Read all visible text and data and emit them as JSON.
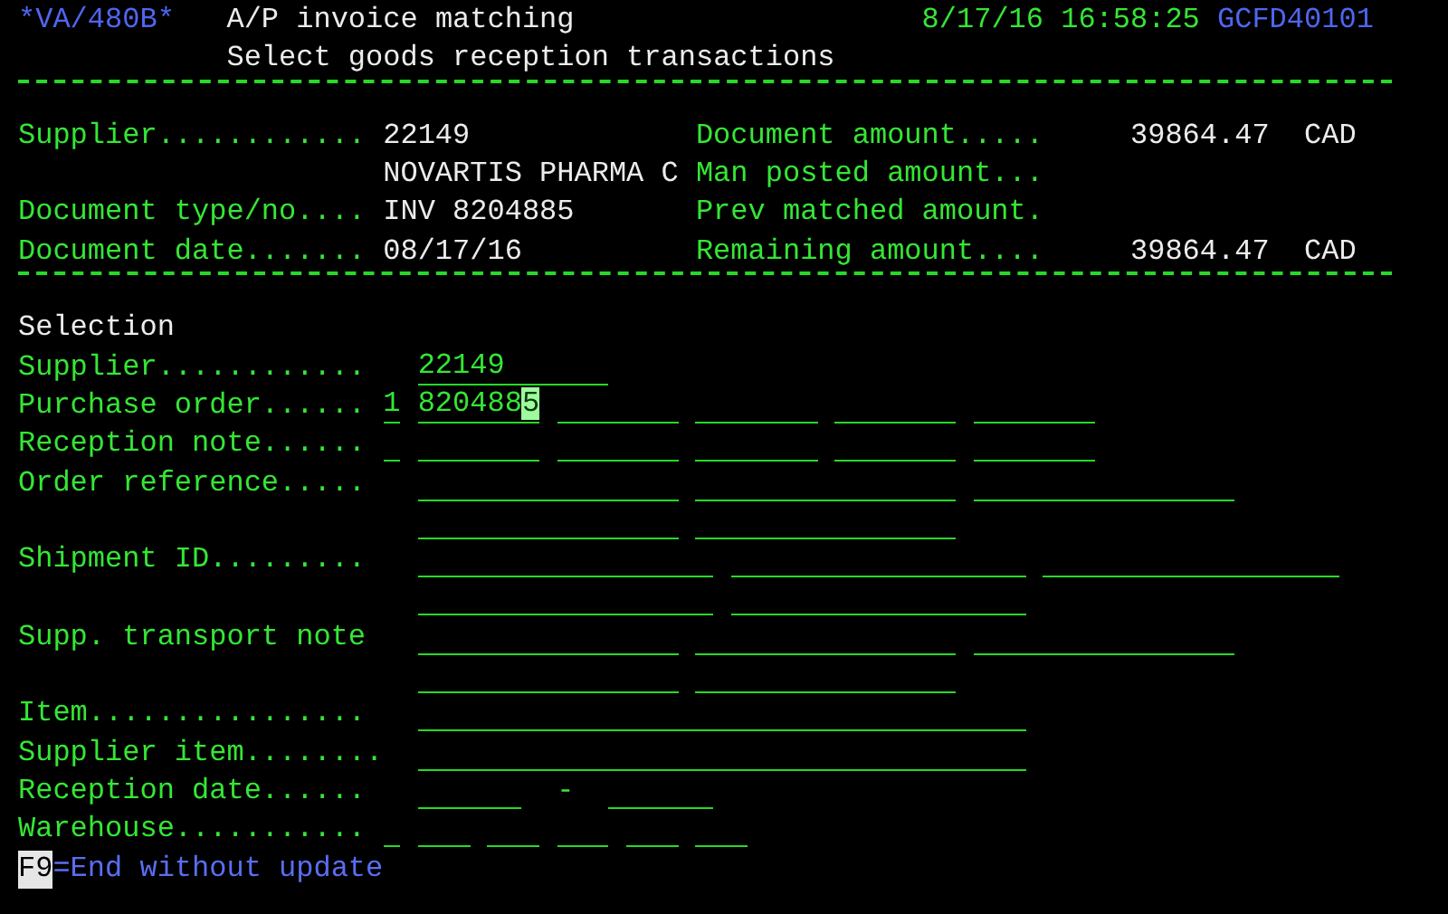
{
  "header": {
    "program_id": "*VA/480B*",
    "title": "A/P invoice matching",
    "subtitle": "Select goods reception transactions",
    "datetime": "8/17/16 16:58:25",
    "terminal_id": "GCFD40101"
  },
  "document_info": [
    {
      "label": "Supplier............",
      "value": "22149",
      "right_label": "Document amount.....",
      "amount": "39864.47",
      "currency": "CAD"
    },
    {
      "value": "NOVARTIS PHARMA C",
      "right_label": "Man posted amount..."
    },
    {
      "label": "Document type/no....",
      "value": "INV 8204885",
      "right_label": "Prev matched amount."
    },
    {
      "label": "Document date.......",
      "value": "08/17/16",
      "right_label": "Remaining amount....",
      "amount": "39864.47",
      "currency": "CAD"
    }
  ],
  "selection": {
    "heading": "Selection",
    "rows": [
      {
        "kind": "short",
        "label": "Supplier............",
        "lines": [
          [
            {
              "value": "22149",
              "cursor": false
            }
          ]
        ]
      },
      {
        "kind": "grid7",
        "label": "Purchase order......",
        "prefix": {
          "value": "1",
          "cursor": false
        },
        "lines": [
          [
            {
              "value": "8204885",
              "cursor": true
            },
            {
              "cursor": false
            },
            {
              "cursor": false
            },
            {
              "cursor": false
            },
            {
              "cursor": false
            }
          ]
        ]
      },
      {
        "kind": "grid7",
        "label": "Reception note......",
        "prefix": {
          "cursor": false
        },
        "lines": [
          [
            {
              "cursor": false
            },
            {
              "cursor": false
            },
            {
              "cursor": false
            },
            {
              "cursor": false
            },
            {
              "cursor": false
            }
          ]
        ]
      },
      {
        "kind": "ref",
        "label": "Order reference.....",
        "lines": [
          [
            {
              "cursor": false
            },
            {
              "cursor": false
            },
            {
              "cursor": false
            }
          ],
          [
            {
              "cursor": false
            },
            {
              "cursor": false
            }
          ]
        ]
      },
      {
        "kind": "ship",
        "label": "Shipment ID.........",
        "lines": [
          [
            {
              "cursor": false
            },
            {
              "cursor": false
            },
            {
              "cursor": false
            }
          ],
          [
            {
              "cursor": false
            },
            {
              "cursor": false
            }
          ]
        ]
      },
      {
        "kind": "ref",
        "label": "Supp. transport note",
        "lines": [
          [
            {
              "cursor": false
            },
            {
              "cursor": false
            },
            {
              "cursor": false
            }
          ],
          [
            {
              "cursor": false
            },
            {
              "cursor": false
            }
          ]
        ]
      },
      {
        "kind": "long",
        "label": "Item................",
        "lines": [
          [
            {
              "cursor": false
            }
          ]
        ]
      },
      {
        "kind": "long",
        "label": "Supplier item........",
        "lines": [
          [
            {
              "cursor": false
            }
          ]
        ]
      },
      {
        "kind": "range",
        "label": "Reception date......",
        "separator": "-",
        "lines": [
          [
            {
              "cursor": false
            },
            {
              "cursor": false
            }
          ]
        ]
      },
      {
        "kind": "grid3",
        "label": "Warehouse...........",
        "prefix": {
          "cursor": false
        },
        "lines": [
          [
            {
              "cursor": false
            },
            {
              "cursor": false
            },
            {
              "cursor": false
            },
            {
              "cursor": false
            },
            {
              "cursor": false
            }
          ]
        ]
      }
    ]
  },
  "footer": {
    "key": "F9",
    "text": "=End without update"
  }
}
